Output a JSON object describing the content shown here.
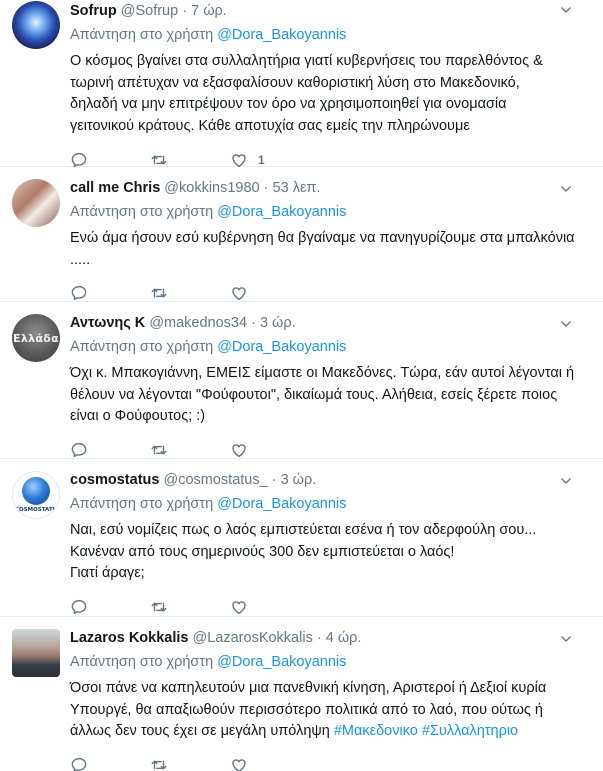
{
  "reply_prefix": "Απάντηση στο χρήστη",
  "tweets": [
    {
      "name": "Sofrup",
      "handle": "@Sofrup",
      "time": "7 ώρ.",
      "reply_to": "@Dora_Bakoyannis",
      "text": [
        "Ο κόσμος βγαίνει στα συλλαλητήρια γιατί κυβερνήσεις του παρελθόντος &",
        "τωρινή απέτυχαν να εξασφαλίσουν καθοριστική λύση στο Μακεδονικό,",
        "δηλαδή να μην επιτρέψουν τον όρο να χρησιμοποιηθεί για ονομασία",
        "γειτονικού κράτους. Κάθε αποτυχία σας εμείς την πληρώνουμε"
      ],
      "like_count": "1",
      "avatar": "colorful-orb-avatar"
    },
    {
      "name": "call me Chris",
      "handle": "@kokkins1980",
      "time": "53 λεπ.",
      "reply_to": "@Dora_Bakoyannis",
      "text": [
        "Ενώ άμα ήσουν εσύ κυβέρνηση θα βγαίναμε να πανηγυρίζουμε στα μπαλκόνια",
        "....."
      ],
      "like_count": "",
      "avatar": "photo-avatar"
    },
    {
      "name": "Αντωνης Κ",
      "handle": "@makednos34",
      "time": "3 ώρ.",
      "reply_to": "@Dora_Bakoyannis",
      "text": [
        "Όχι κ. Μπακογιάννη, ΕΜΕΙΣ είμαστε οι Μακεδόνες. Τώρα, εάν αυτοί λέγονται ή",
        "θέλουν να λέγονται \"Φούφουτοι\", δικαίωμά τους. Αλήθεια, εσείς ξέρετε ποιος",
        "είναι ο Φούφουτος; :)"
      ],
      "like_count": "",
      "avatar_text": "Ελλάδα"
    },
    {
      "name": "cosmostatus",
      "handle": "@cosmostatus_",
      "time": "3 ώρ.",
      "reply_to": "@Dora_Bakoyannis",
      "text": [
        "Ναι, εσύ νομίζεις πως ο λαός εμπιστεύεται εσένα ή τον αδερφούλη σου...",
        "Κανέναν από τους σημερινούς 300 δεν εμπιστεύεται ο λαός!",
        "Γιατί άραγε;"
      ],
      "like_count": "",
      "avatar_text": "COSMOSTATU"
    },
    {
      "name": "Lazaros Kokkalis",
      "handle": "@LazarosKokkalis",
      "time": "4 ώρ.",
      "reply_to": "@Dora_Bakoyannis",
      "text": [
        "Όσοι πάνε να καπηλευτούν μια πανεθνική κίνηση, Αριστεροί ή Δεξιοί κυρία",
        "Υπουργέ, θα απαξιωθούν περισσότερο πολιτικά από το λαό, που ούτως ή",
        "άλλως δεν τους έχει σε μεγάλη υπόληψη"
      ],
      "hashtags": [
        "#Μακεδονικο",
        "#Συλλαλητηριο"
      ],
      "like_count": "",
      "avatar": "man-portrait-avatar"
    }
  ]
}
